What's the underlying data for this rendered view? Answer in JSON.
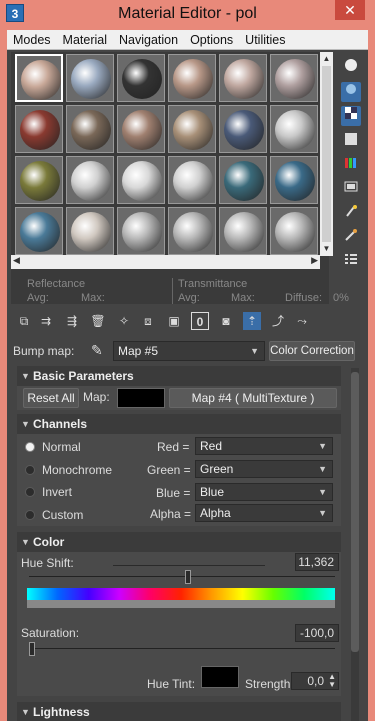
{
  "window": {
    "title": "Material Editor - pol",
    "app_icon": "3",
    "close_glyph": "✕"
  },
  "menu": [
    "Modes",
    "Material",
    "Navigation",
    "Options",
    "Utilities"
  ],
  "slots": [
    [
      "#c8a898",
      "#9aaac0",
      "#333333",
      "#b89888",
      "#c0a8a0",
      "#b0a0a0"
    ],
    [
      "#8a3a30",
      "#7a6858",
      "#a08070",
      "#a89078",
      "#4a5a78",
      "#c8c8c8"
    ],
    [
      "#7a7a3a",
      "#d0d0d0",
      "#d8d8d8",
      "#d0d0d0",
      "#3a6a7a",
      "#3a6a88"
    ],
    [
      "#4a7a98",
      "#d0c8c0",
      "#b8b8b8",
      "#b8b8b8",
      "#b8b8b8",
      "#b8b8b8"
    ]
  ],
  "side_tools": [
    "sphere-icon",
    "backlight-icon",
    "checker-background-icon",
    "box-icon",
    "color-bars-icon",
    "video-check-icon",
    "magic-wand-icon",
    "pick-material-icon",
    "options-icon"
  ],
  "reflectance": {
    "reflectance_label": "Reflectance",
    "transmittance_label": "Transmittance",
    "avg_label": "Avg:",
    "max_label": "Max:",
    "avg2_label": "Avg:",
    "max2_label": "Max:",
    "diffuse_label": "Diffuse:",
    "diffuse_value": "0%"
  },
  "bump": {
    "label": "Bump map:",
    "map_value": "Map #5",
    "color_correction": "Color Correction"
  },
  "basic": {
    "title": "Basic Parameters",
    "reset_all": "Reset All",
    "map_label": "Map:",
    "map_button": "Map #4  ( MultiTexture )"
  },
  "channels": {
    "title": "Channels",
    "options": [
      "Normal",
      "Monochrome",
      "Invert",
      "Custom"
    ],
    "selected": "Normal",
    "red_label": "Red =",
    "green_label": "Green =",
    "blue_label": "Blue =",
    "alpha_label": "Alpha =",
    "red_value": "Red",
    "green_value": "Green",
    "blue_value": "Blue",
    "alpha_value": "Alpha"
  },
  "color": {
    "title": "Color",
    "hue_shift_label": "Hue Shift:",
    "hue_shift_value": "11,362",
    "saturation_label": "Saturation:",
    "saturation_value": "-100,0",
    "hue_tint_label": "Hue Tint:",
    "strength_label": "Strength:",
    "strength_value": "0,0"
  },
  "lightness": {
    "title": "Lightness"
  }
}
